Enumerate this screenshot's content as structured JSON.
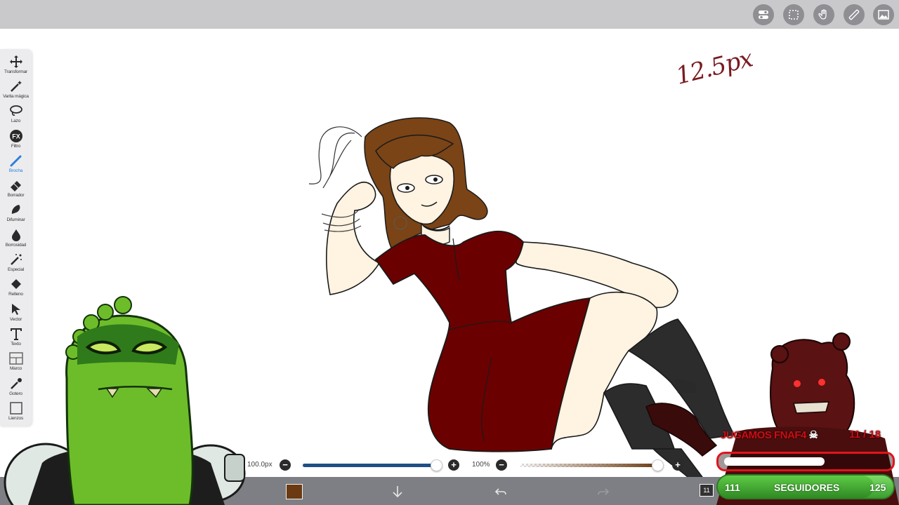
{
  "app": {
    "top_icons": [
      "toggle-icon",
      "selection-icon",
      "hand-icon",
      "ruler-icon",
      "gallery-icon"
    ]
  },
  "toolbar": {
    "tools": [
      {
        "label": "Transformar",
        "icon": "move-arrows-icon"
      },
      {
        "label": "Varita mágica",
        "icon": "magic-wand-icon"
      },
      {
        "label": "Lazo",
        "icon": "lasso-icon"
      },
      {
        "label": "Filtro",
        "icon": "fx-icon"
      },
      {
        "label": "Brocha",
        "icon": "brush-icon"
      },
      {
        "label": "Borrador",
        "icon": "eraser-icon"
      },
      {
        "label": "Difuminar",
        "icon": "smudge-icon"
      },
      {
        "label": "Borrosidad",
        "icon": "blur-drop-icon"
      },
      {
        "label": "Especial",
        "icon": "sparkle-wand-icon"
      },
      {
        "label": "Relleno",
        "icon": "fill-bucket-icon"
      },
      {
        "label": "Vector",
        "icon": "cursor-arrow-icon"
      },
      {
        "label": "Texto",
        "icon": "text-t-icon"
      },
      {
        "label": "Marco",
        "icon": "frame-divider-icon"
      },
      {
        "label": "Gotero",
        "icon": "eyedropper-icon"
      },
      {
        "label": "Lienzos",
        "icon": "canvas-icon"
      }
    ],
    "active_tool": "Brocha",
    "accent_color": "#2f7fd8"
  },
  "canvas": {
    "handwritten_note": "12.5px"
  },
  "brush": {
    "size_value": "100.0px",
    "size_level": 0.97,
    "opacity_value": "100%",
    "opacity_level": 1.0,
    "current_color": "#6b3a12"
  },
  "bottom_bar": {
    "icons": [
      "color-swatch",
      "download-arrow-icon",
      "undo-icon",
      "redo-icon"
    ]
  },
  "stream_overlay": {
    "title": "JUGAMOS FNAF4",
    "title_icon": "skull-icon",
    "counter_current": "11",
    "counter_total": "18",
    "progress_level": 0.6,
    "followers_label": "SEGUIDORES",
    "followers_current": "111",
    "followers_goal": "125",
    "badge": "11"
  },
  "colors": {
    "dress": "#6b0000",
    "hair": "#7a4416",
    "skin": "#fff3e2",
    "stockings": "#2c2c2c",
    "alert_red": "#e0141c",
    "followers_green": "#4fbf3a"
  }
}
